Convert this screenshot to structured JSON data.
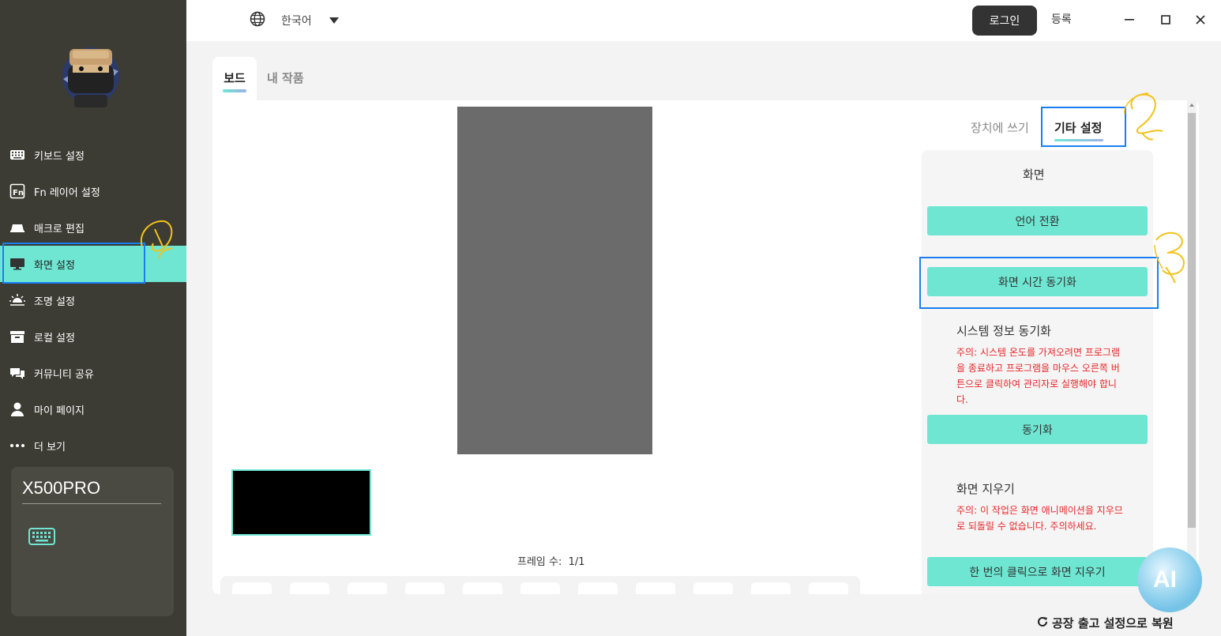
{
  "sidebar": {
    "items": [
      {
        "label": "키보드 설정",
        "icon": "keyboard-icon"
      },
      {
        "label": "Fn 레이어 설정",
        "icon": "fn-icon"
      },
      {
        "label": "매크로 편집",
        "icon": "macro-icon"
      },
      {
        "label": "화면 설정",
        "icon": "monitor-icon",
        "active": true
      },
      {
        "label": "조명 설정",
        "icon": "sunrise-icon"
      },
      {
        "label": "로컬 설정",
        "icon": "archive-icon"
      },
      {
        "label": "커뮤니티 공유",
        "icon": "chat-icon"
      },
      {
        "label": "마이 페이지",
        "icon": "user-icon"
      },
      {
        "label": "더 보기",
        "icon": "more-icon"
      }
    ],
    "device": {
      "name": "X500PRO",
      "icon": "keyboard-icon"
    }
  },
  "topbar": {
    "language": "한국어",
    "login": "로그인",
    "register": "등록"
  },
  "main": {
    "tabs": [
      {
        "label": "보드",
        "active": true
      },
      {
        "label": "내 작품",
        "active": false
      }
    ],
    "frame_count_label": "프레임 수:",
    "frame_count_value": "1/1"
  },
  "settings": {
    "tabs": [
      {
        "label": "장치에 쓰기",
        "active": false
      },
      {
        "label": "기타 설정",
        "active": true
      }
    ],
    "screen_title": "화면",
    "language_switch": "언어 전환",
    "sync_time": "화면 시간 동기화",
    "sys_info_title": "시스템 정보 동기화",
    "sys_info_warning": "주의: 시스템 온도를 가져오려면 프로그램을 종료하고 프로그램을 마우스 오른쪽 버튼으로 클릭하여 관리자로 실행해야 합니다.",
    "sync_button": "동기화",
    "clear_title": "화면 지우기",
    "clear_warning": "주의: 이 작업은 화면 애니메이션을 지우므로 되돌릴 수 없습니다. 주의하세요.",
    "clear_button": "한 번의 클릭으로 화면 지우기"
  },
  "footer": {
    "restore": "공장 출고 설정으로 복원"
  },
  "annotations": [
    "1",
    "2",
    "3"
  ],
  "ai_badge": "AI",
  "colors": {
    "sidebar_bg": "#3c3c34",
    "accent": "#6ee6d2",
    "highlight_box": "#1a7ef0",
    "annotation_marker": "#f2c21a",
    "warning_text": "#e8262a"
  }
}
